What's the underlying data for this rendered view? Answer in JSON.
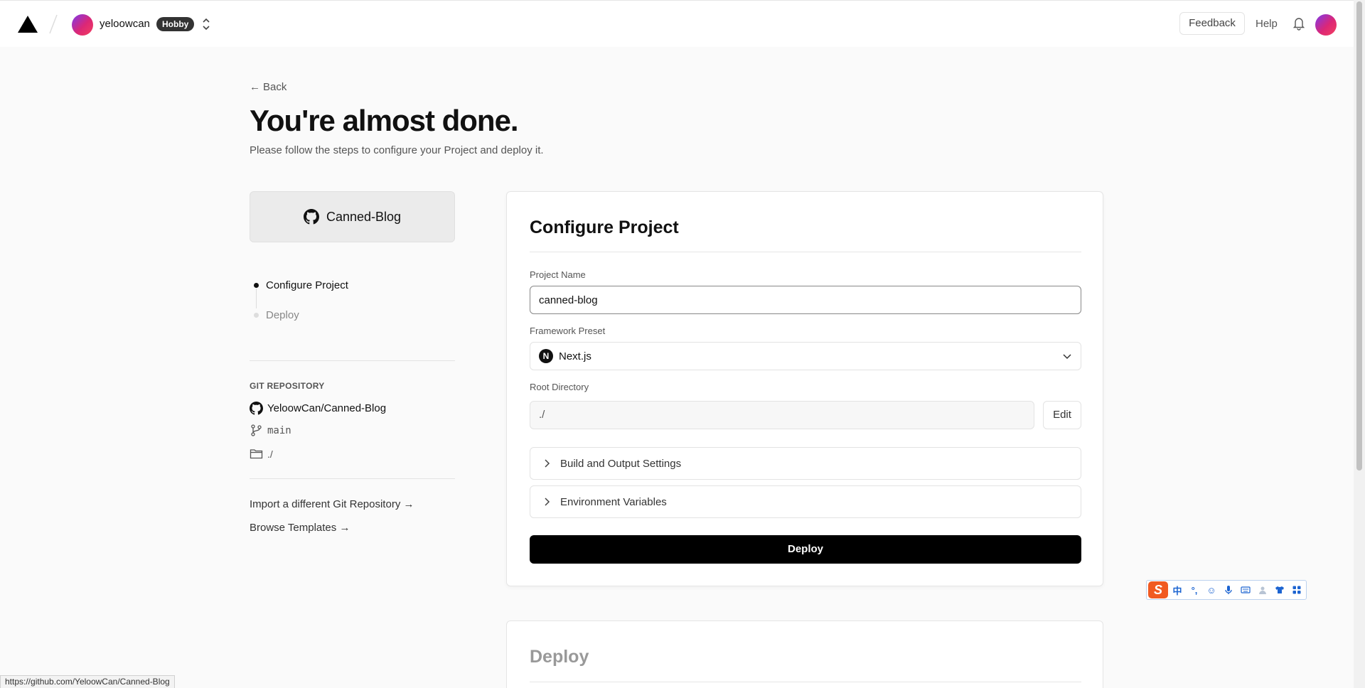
{
  "nav": {
    "team_name": "yeloowcan",
    "plan_badge": "Hobby",
    "feedback_label": "Feedback",
    "help_label": "Help"
  },
  "header": {
    "back_label": "Back",
    "title": "You're almost done.",
    "subtitle": "Please follow the steps to configure your Project and deploy it."
  },
  "repo_card": {
    "name": "Canned-Blog"
  },
  "steps": [
    {
      "label": "Configure Project",
      "active": true
    },
    {
      "label": "Deploy",
      "active": false
    }
  ],
  "git": {
    "heading": "GIT REPOSITORY",
    "repo": "YeloowCan/Canned-Blog",
    "branch": "main",
    "directory": "./"
  },
  "links": {
    "import_repo": "Import a different Git Repository →",
    "browse_templates": "Browse Templates →"
  },
  "configure": {
    "title": "Configure Project",
    "project_name_label": "Project Name",
    "project_name_value": "canned-blog",
    "framework_label": "Framework Preset",
    "framework_value": "Next.js",
    "framework_icon_letter": "N",
    "root_dir_label": "Root Directory",
    "root_dir_value": "./",
    "edit_label": "Edit",
    "build_settings_label": "Build and Output Settings",
    "env_vars_label": "Environment Variables",
    "deploy_label": "Deploy"
  },
  "deploy_section": {
    "title": "Deploy"
  },
  "ime": {
    "logo": "S",
    "buttons": [
      "中",
      "°,",
      "☺",
      "mic-icon",
      "keyboard-icon",
      "user-icon",
      "shirt-icon",
      "grid-icon"
    ]
  },
  "status_url": "https://github.com/YeloowCan/Canned-Blog",
  "colors": {
    "accent": "#000000",
    "avatar_gradient": [
      "#7c3aed",
      "#db2777"
    ]
  }
}
